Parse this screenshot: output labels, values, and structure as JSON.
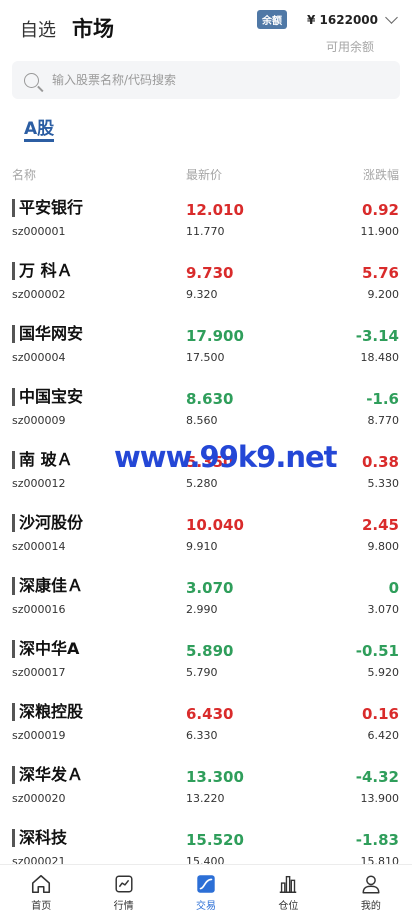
{
  "header": {
    "tab_self": "自选",
    "tab_market": "市场",
    "balance_badge": "余额",
    "balance_amount": "¥ 1622000",
    "balance_label": "可用余额"
  },
  "search": {
    "placeholder": "输入股票名称/代码搜索"
  },
  "category_tab": "A股",
  "columns": {
    "name": "名称",
    "price": "最新价",
    "change": "涨跌幅"
  },
  "stocks": [
    {
      "name": "平安银行",
      "code": "sz000001",
      "price": "12.010",
      "prev": "11.770",
      "change": "0.92",
      "base": "11.900",
      "dir": "up"
    },
    {
      "name": "万 科Ａ",
      "code": "sz000002",
      "price": "9.730",
      "prev": "9.320",
      "change": "5.76",
      "base": "9.200",
      "dir": "up"
    },
    {
      "name": "国华网安",
      "code": "sz000004",
      "price": "17.900",
      "prev": "17.500",
      "change": "-3.14",
      "base": "18.480",
      "dir": "down"
    },
    {
      "name": "中国宝安",
      "code": "sz000009",
      "price": "8.630",
      "prev": "8.560",
      "change": "-1.6",
      "base": "8.770",
      "dir": "down"
    },
    {
      "name": "南 玻Ａ",
      "code": "sz000012",
      "price": "5.350",
      "prev": "5.280",
      "change": "0.38",
      "base": "5.330",
      "dir": "up"
    },
    {
      "name": "沙河股份",
      "code": "sz000014",
      "price": "10.040",
      "prev": "9.910",
      "change": "2.45",
      "base": "9.800",
      "dir": "up"
    },
    {
      "name": "深康佳Ａ",
      "code": "sz000016",
      "price": "3.070",
      "prev": "2.990",
      "change": "0",
      "base": "3.070",
      "dir": "flat"
    },
    {
      "name": "深中华A",
      "code": "sz000017",
      "price": "5.890",
      "prev": "5.790",
      "change": "-0.51",
      "base": "5.920",
      "dir": "down"
    },
    {
      "name": "深粮控股",
      "code": "sz000019",
      "price": "6.430",
      "prev": "6.330",
      "change": "0.16",
      "base": "6.420",
      "dir": "up"
    },
    {
      "name": "深华发Ａ",
      "code": "sz000020",
      "price": "13.300",
      "prev": "13.220",
      "change": "-4.32",
      "base": "13.900",
      "dir": "down"
    },
    {
      "name": "深科技",
      "code": "sz000021",
      "price": "15.520",
      "prev": "15.400",
      "change": "-1.83",
      "base": "15.810",
      "dir": "down"
    }
  ],
  "watermark": "www.99k9.net",
  "nav": [
    {
      "label": "首页",
      "icon": "home-icon"
    },
    {
      "label": "行情",
      "icon": "chart-icon"
    },
    {
      "label": "交易",
      "icon": "trade-icon",
      "active": true
    },
    {
      "label": "仓位",
      "icon": "position-icon"
    },
    {
      "label": "我的",
      "icon": "profile-icon"
    }
  ],
  "colors": {
    "up": "#d92b2b",
    "down": "#2f9e5b",
    "accent": "#2c6fd6",
    "badge": "#4f78a6"
  }
}
